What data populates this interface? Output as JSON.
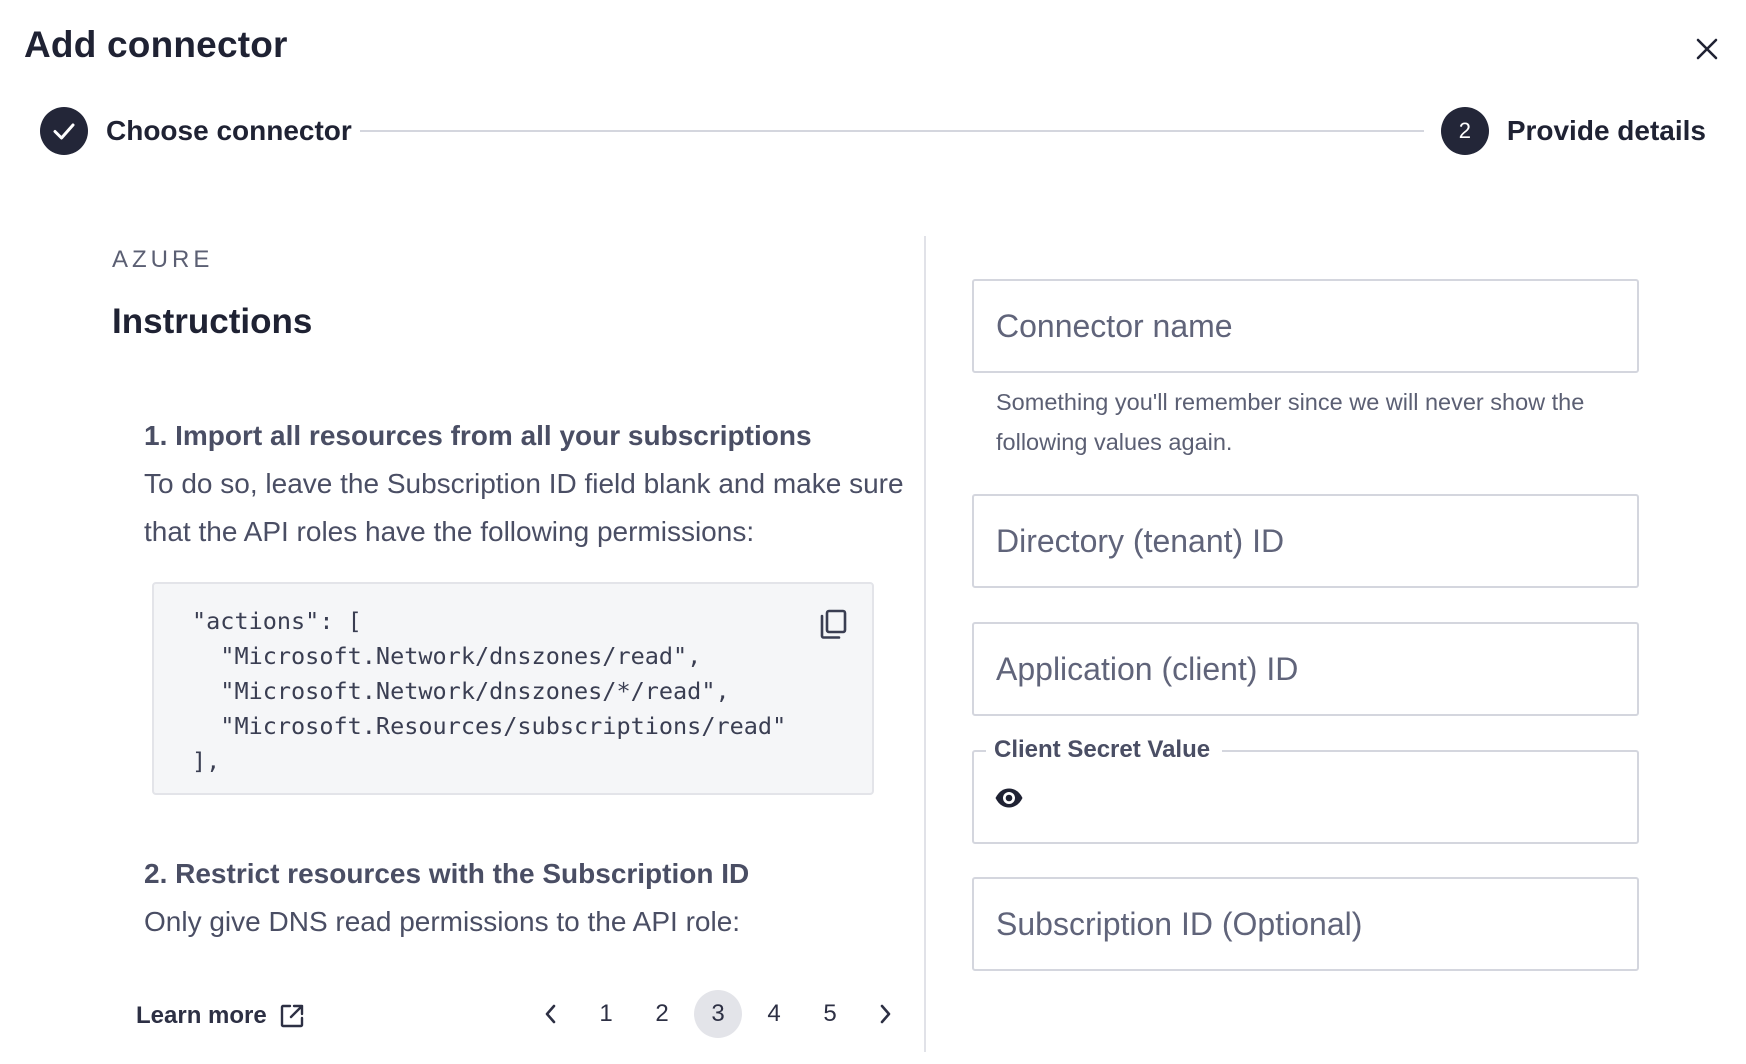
{
  "modal": {
    "title": "Add connector",
    "close_icon": "close-icon"
  },
  "stepper": {
    "steps": [
      {
        "label": "Choose connector",
        "state": "completed",
        "icon": "check-icon"
      },
      {
        "label": "Provide details",
        "state": "active",
        "number": "2"
      }
    ]
  },
  "instructions": {
    "provider": "AZURE",
    "title": "Instructions",
    "steps": [
      {
        "heading": "1. Import all resources from all your subscriptions",
        "body": "To do so, leave the Subscription ID field blank and make sure that the API roles have the following permissions:"
      },
      {
        "heading": "2. Restrict resources with the Subscription ID",
        "body": "Only give DNS read permissions to the API role:"
      }
    ],
    "code": "\"actions\": [\n  \"Microsoft.Network/dnszones/read\",\n  \"Microsoft.Network/dnszones/*/read\",\n  \"Microsoft.Resources/subscriptions/read\"\n],",
    "copy_icon": "copy-icon",
    "learn_more": "Learn more",
    "external_icon": "external-link-icon"
  },
  "pagination": {
    "prev_icon": "chevron-left-icon",
    "next_icon": "chevron-right-icon",
    "pages": [
      "1",
      "2",
      "3",
      "4",
      "5"
    ],
    "current": "3"
  },
  "form": {
    "connector_name": {
      "placeholder": "Connector name",
      "value": ""
    },
    "connector_name_helper": "Something you'll remember since we will never show the following values again.",
    "directory_id": {
      "placeholder": "Directory (tenant) ID",
      "value": ""
    },
    "application_id": {
      "placeholder": "Application (client) ID",
      "value": ""
    },
    "client_secret": {
      "label": "Client Secret Value",
      "value": "",
      "icon": "eye-icon"
    },
    "subscription_id": {
      "placeholder": "Subscription ID (Optional)",
      "value": ""
    }
  }
}
